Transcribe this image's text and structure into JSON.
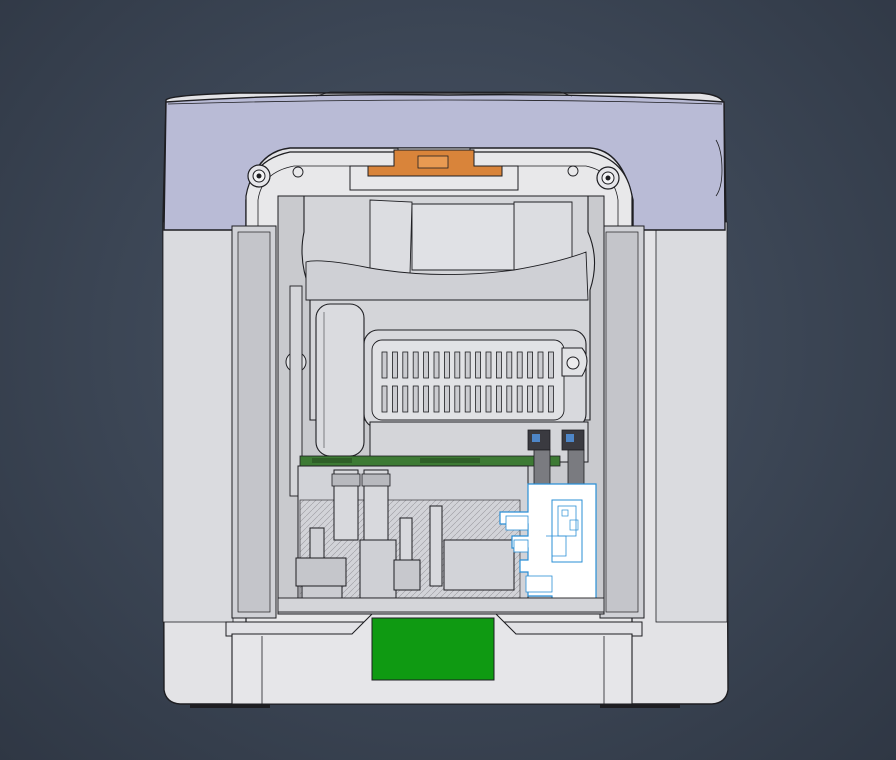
{
  "scene": {
    "view": "cad-front-view",
    "background_color": "#3e4757",
    "colors": {
      "housing": "#e3e3e6",
      "housing_shade": "#cfd0d6",
      "top_cap": "#b9bbd6",
      "outline": "#1e1e22",
      "inner_panel": "#c7c8cc",
      "orange_latch": "#d9843a",
      "green_board": "#0f9a12",
      "pcb": "#3d7a34",
      "highlight": "#ffffff",
      "highlight_outline": "#2a8fd6",
      "connector_dark": "#3a3a40",
      "connector_blue": "#4e86c8"
    }
  }
}
